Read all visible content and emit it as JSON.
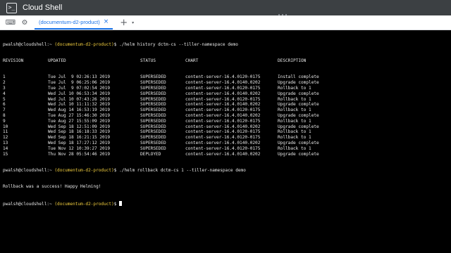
{
  "app": {
    "title": "Cloud Shell",
    "logo_glyph": ">_"
  },
  "toolbar": {
    "keyboard_icon_glyph": "⌨",
    "settings_icon_glyph": "⚙",
    "tab_label": "(documentum-d2-product)",
    "tab_close": "×",
    "add_tab": "+",
    "tab_menu": "▾"
  },
  "colors": {
    "prompt_project": "#f4d03f",
    "tab_accent": "#1a73e8",
    "header_bg": "#3c4043",
    "terminal_bg": "#000000"
  },
  "prompt": {
    "user": "pwalsh@cloudshell:~",
    "project": "(documentum-d2-product)",
    "symbol": "$"
  },
  "terminal": {
    "cmd1": "./helm history dctm-cs --tiller-namespace demo",
    "headers": [
      "REVISION",
      "UPDATED",
      "STATUS",
      "CHART",
      "DESCRIPTION"
    ],
    "rows": [
      [
        "1",
        "Tue Jul  9 02:26:13 2019",
        "SUPERSEDED",
        "content-server-16.4.0120-0175",
        "Install complete"
      ],
      [
        "2",
        "Tue Jul  9 06:25:06 2019",
        "SUPERSEDED",
        "content-server-16.4.0140.0202",
        "Upgrade complete"
      ],
      [
        "3",
        "Tue Jul  9 07:02:54 2019",
        "SUPERSEDED",
        "content-server-16.4.0120-0175",
        "Rollback to 1"
      ],
      [
        "4",
        "Wed Jul 10 06:53:34 2019",
        "SUPERSEDED",
        "content-server-16.4.0140.0202",
        "Upgrade complete"
      ],
      [
        "5",
        "Wed Jul 10 07:43:26 2019",
        "SUPERSEDED",
        "content-server-16.4.0120-0175",
        "Rollback to 1"
      ],
      [
        "6",
        "Wed Jul 10 11:11:32 2019",
        "SUPERSEDED",
        "content-server-16.4.0140.0202",
        "Upgrade complete"
      ],
      [
        "7",
        "Wed Aug 14 16:53:19 2019",
        "SUPERSEDED",
        "content-server-16.4.0120-0175",
        "Rollback to 1"
      ],
      [
        "8",
        "Tue Aug 27 15:46:30 2019",
        "SUPERSEDED",
        "content-server-16.4.0140.0202",
        "Upgrade complete"
      ],
      [
        "9",
        "Tue Aug 27 15:55:09 2019",
        "SUPERSEDED",
        "content-server-16.4.0120-0175",
        "Rollback to 1"
      ],
      [
        "10",
        "Wed Sep 18 12:51:09 2019",
        "SUPERSEDED",
        "content-server-16.4.0140.0202",
        "Upgrade complete"
      ],
      [
        "11",
        "Wed Sep 18 16:18:33 2019",
        "SUPERSEDED",
        "content-server-16.4.0120-0175",
        "Rollback to 1"
      ],
      [
        "12",
        "Wed Sep 18 16:21:15 2019",
        "SUPERSEDED",
        "content-server-16.4.0120-0175",
        "Rollback to 1"
      ],
      [
        "13",
        "Wed Sep 18 17:27:12 2019",
        "SUPERSEDED",
        "content-server-16.4.0140.0202",
        "Upgrade complete"
      ],
      [
        "14",
        "Tue Nov 12 10:39:27 2019",
        "SUPERSEDED",
        "content-server-16.4.0120-0175",
        "Rollback to 1"
      ],
      [
        "15",
        "Thu Nov 28 05:54:46 2019",
        "DEPLOYED",
        "content-server-16.4.0140.0202",
        "Upgrade complete"
      ]
    ],
    "cmd2": "./helm rollback dctm-cs 1 --tiller-namespace demo",
    "output": "Rollback was a success! Happy Helming!"
  }
}
